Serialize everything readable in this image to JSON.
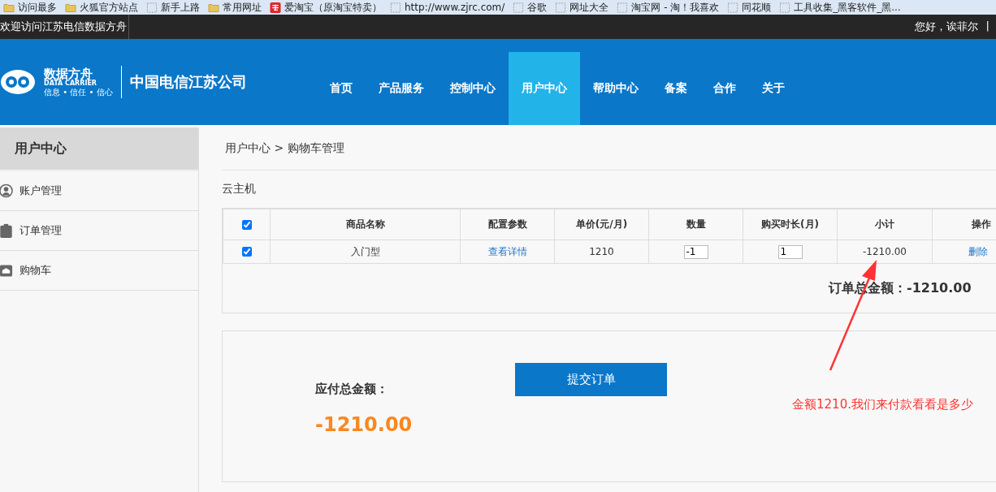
{
  "bookmarks": [
    {
      "label": "访问最多",
      "kind": "folder"
    },
    {
      "label": "火狐官方站点",
      "kind": "folder"
    },
    {
      "label": "新手上路",
      "kind": "page"
    },
    {
      "label": "常用网址",
      "kind": "folder"
    },
    {
      "label": "爱淘宝（原淘宝特卖）",
      "kind": "taobao"
    },
    {
      "label": "http://www.zjrc.com/",
      "kind": "page"
    },
    {
      "label": "谷歌",
      "kind": "page"
    },
    {
      "label": "网址大全",
      "kind": "page"
    },
    {
      "label": "淘宝网 - 淘！我喜欢",
      "kind": "page"
    },
    {
      "label": "同花顺",
      "kind": "page"
    },
    {
      "label": "工具收集_黑客软件_黑...",
      "kind": "page"
    }
  ],
  "top_bar": {
    "welcome": "欢迎访问江苏电信数据方舟",
    "greeting": "您好，诶菲尔",
    "separator": "|"
  },
  "header": {
    "logo_title": "数据方舟",
    "logo_subtitle": "DATA CARRIER",
    "logo_slogan": "信息 • 信任 • 信心",
    "company": "中国电信江苏公司",
    "nav": [
      {
        "label": "首页",
        "selected": false
      },
      {
        "label": "产品服务",
        "selected": false
      },
      {
        "label": "控制中心",
        "selected": false
      },
      {
        "label": "用户中心",
        "selected": true
      },
      {
        "label": "帮助中心",
        "selected": false
      },
      {
        "label": "备案",
        "selected": false
      },
      {
        "label": "合作",
        "selected": false
      },
      {
        "label": "关于",
        "selected": false
      }
    ]
  },
  "sidebar": {
    "title": "用户中心",
    "items": [
      {
        "label": "账户管理",
        "kind": "user"
      },
      {
        "label": "订单管理",
        "kind": "clipboard"
      },
      {
        "label": "购物车",
        "kind": "cart"
      }
    ]
  },
  "breadcrumb": "用户中心 > 购物车管理",
  "section_title": "云主机",
  "table": {
    "header_checked": true,
    "columns": [
      "商品名称",
      "配置参数",
      "单价(元/月)",
      "数量",
      "购买时长(月)",
      "小计",
      "操作"
    ],
    "rows": [
      {
        "checked": true,
        "name": "入门型",
        "config_link": "查看详情",
        "price": "1210",
        "quantity": "-1",
        "duration": "1",
        "subtotal": "-1210.00",
        "action": "删除"
      }
    ],
    "total_label": "订单总金额：",
    "total_value": "-1210.00"
  },
  "payment": {
    "label": "应付总金额：",
    "amount": "-1210.00",
    "submit": "提交订单"
  },
  "annotation": "金额1210.我们来付款看看是多少"
}
